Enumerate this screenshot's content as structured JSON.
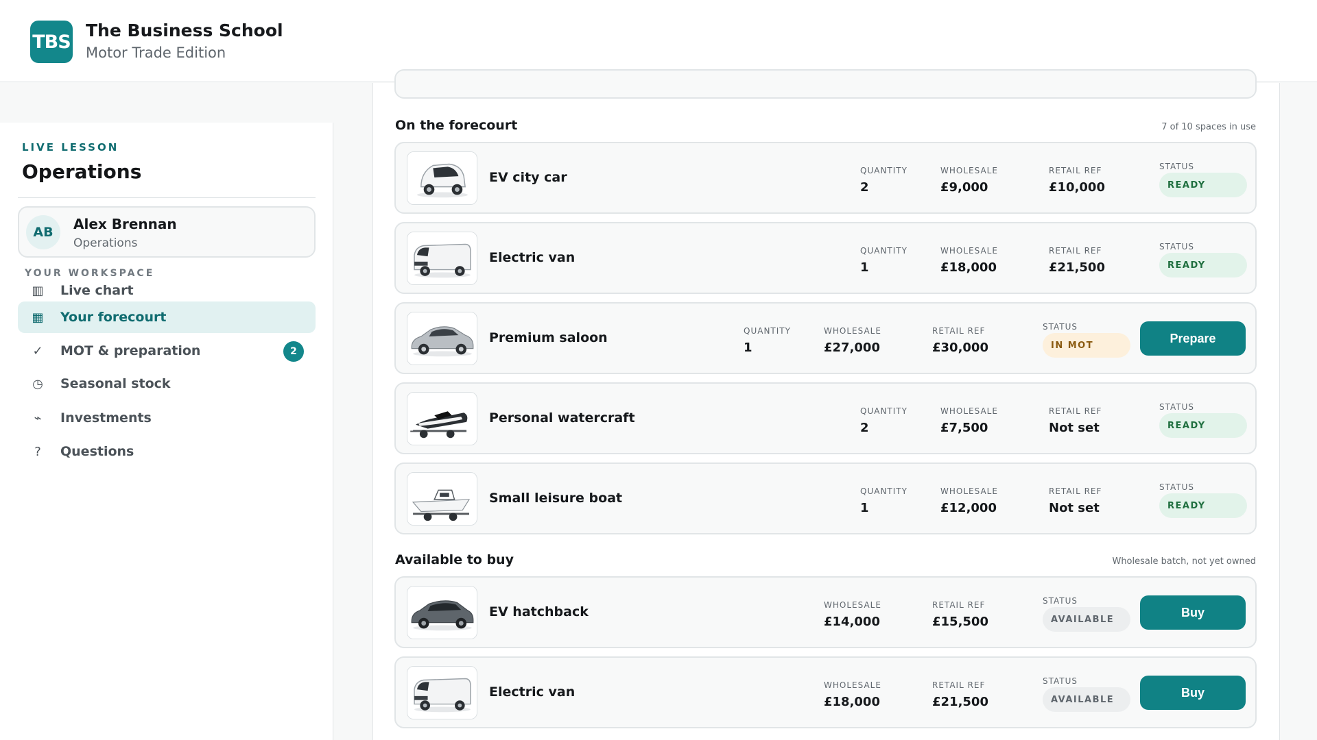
{
  "header": {
    "logo_text": "TBS",
    "title": "The Business School",
    "subtitle": "Motor Trade Edition"
  },
  "sidebar": {
    "kicker": "LIVE LESSON",
    "title": "Operations",
    "user": {
      "initials": "AB",
      "name": "Alex Brennan",
      "role": "Operations"
    },
    "workspace_label": "YOUR WORKSPACE",
    "items": [
      {
        "label": "Live chart",
        "icon": "bar-chart-icon",
        "glyph": "▥",
        "active": false
      },
      {
        "label": "Your forecourt",
        "icon": "grid-icon",
        "glyph": "▦",
        "active": true
      },
      {
        "label": "MOT & preparation",
        "icon": "check-icon",
        "glyph": "✓",
        "active": false,
        "badge": "2"
      },
      {
        "label": "Seasonal stock",
        "icon": "clock-icon",
        "glyph": "◷",
        "active": false
      },
      {
        "label": "Investments",
        "icon": "trend-icon",
        "glyph": "⌁",
        "active": false
      },
      {
        "label": "Questions",
        "icon": "question-icon",
        "glyph": "?",
        "active": false
      }
    ]
  },
  "forecourt": {
    "title": "On the forecourt",
    "meta": "7 of 10 spaces in use",
    "labels": {
      "quantity": "QUANTITY",
      "wholesale": "WHOLESALE",
      "retail": "RETAIL REF",
      "status": "STATUS"
    },
    "rows": [
      {
        "name": "EV city car",
        "quantity": "2",
        "wholesale": "£9,000",
        "retail": "£10,000",
        "status": "READY",
        "status_kind": "ready",
        "image": "city-car-image"
      },
      {
        "name": "Electric van",
        "quantity": "1",
        "wholesale": "£18,000",
        "retail": "£21,500",
        "status": "READY",
        "status_kind": "ready",
        "image": "van-image"
      },
      {
        "name": "Premium saloon",
        "quantity": "1",
        "wholesale": "£27,000",
        "retail": "£30,000",
        "status": "IN MOT",
        "status_kind": "inmot",
        "action": "Prepare",
        "image": "saloon-image"
      },
      {
        "name": "Personal watercraft",
        "quantity": "2",
        "wholesale": "£7,500",
        "retail": "Not set",
        "status": "READY",
        "status_kind": "ready",
        "image": "watercraft-image"
      },
      {
        "name": "Small leisure boat",
        "quantity": "1",
        "wholesale": "£12,000",
        "retail": "Not set",
        "status": "READY",
        "status_kind": "ready",
        "image": "boat-image"
      }
    ]
  },
  "available": {
    "title": "Available to buy",
    "meta": "Wholesale batch, not yet owned",
    "rows": [
      {
        "name": "EV hatchback",
        "wholesale": "£14,000",
        "retail": "£15,500",
        "status": "AVAILABLE",
        "status_kind": "available",
        "action": "Buy",
        "image": "hatchback-image"
      },
      {
        "name": "Electric van",
        "wholesale": "£18,000",
        "retail": "£21,500",
        "status": "AVAILABLE",
        "status_kind": "available",
        "action": "Buy",
        "image": "van-image"
      }
    ]
  },
  "colors": {
    "brand": "#13878b",
    "button": "#108285",
    "ready": "#1f6f3f",
    "inmot": "#8a5a10"
  }
}
